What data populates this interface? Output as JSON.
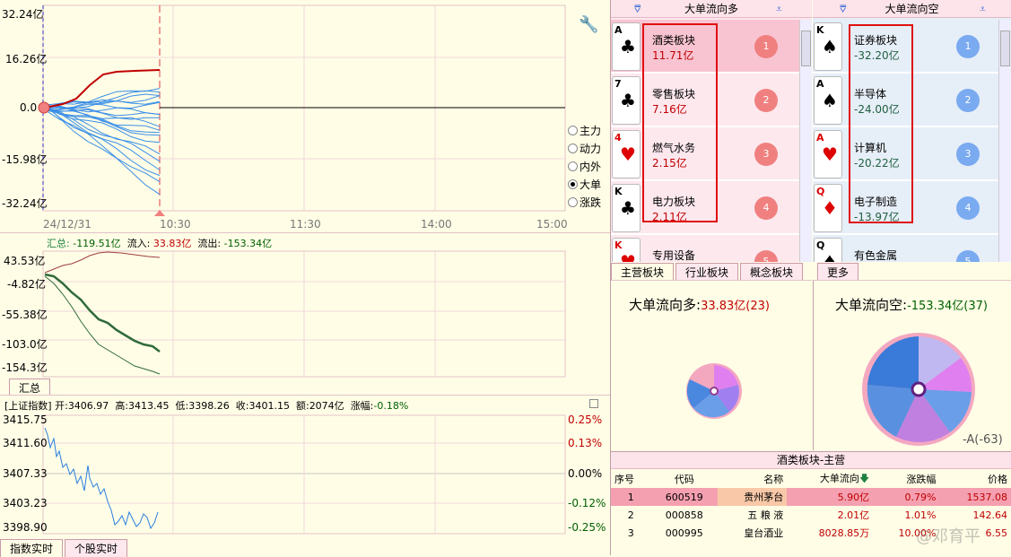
{
  "top_chart": {
    "y_ticks": [
      "32.24亿",
      "16.26亿",
      "0.0",
      "-15.98亿",
      "-32.24亿"
    ],
    "x_ticks": [
      "24/12/31",
      "10:30",
      "11:30",
      "14:00",
      "15:00"
    ],
    "y_range": [
      -32.24,
      32.24
    ],
    "highlight_final": 12.0
  },
  "radio_options": [
    {
      "label": "主力",
      "checked": false
    },
    {
      "label": "动力",
      "checked": false
    },
    {
      "label": "内外",
      "checked": false
    },
    {
      "label": "大单",
      "checked": true
    },
    {
      "label": "涨跌",
      "checked": false
    }
  ],
  "mid_chart": {
    "header": {
      "summary_label": "汇总:",
      "summary_value": "-119.51亿",
      "in_label": "流入:",
      "in_value": "33.83亿",
      "out_label": "流出:",
      "out_value": "-153.34亿"
    },
    "y_ticks": [
      "43.53亿",
      "-4.82亿",
      "-55.38亿",
      "-103.0亿",
      "-154.3亿"
    ],
    "tab": "汇总"
  },
  "index_chart": {
    "header": {
      "name": "[上证指数]",
      "open_label": "开:",
      "open": "3406.97",
      "high_label": "高:",
      "high": "3413.45",
      "low_label": "低:",
      "low": "3398.26",
      "close_label": "收:",
      "close": "3401.15",
      "amount_label": "额:",
      "amount": "2074亿",
      "change_label": "涨幅:",
      "change": "-0.18%"
    },
    "y_left": [
      "3415.75",
      "3411.60",
      "3407.33",
      "3403.23",
      "3398.90"
    ],
    "y_right": [
      "0.25%",
      "0.13%",
      "0.00%",
      "-0.12%",
      "-0.25%"
    ]
  },
  "bottom_tabs": [
    "指数实时",
    "个股实时"
  ],
  "inflow": {
    "title": "大单流向多",
    "items": [
      {
        "card_rank": "A",
        "card_suit": "♣",
        "name": "酒类板块",
        "value": "11.71亿",
        "rank": "1"
      },
      {
        "card_rank": "7",
        "card_suit": "♣",
        "name": "零售板块",
        "value": "7.16亿",
        "rank": "2"
      },
      {
        "card_rank": "4",
        "card_suit": "♥",
        "name": "燃气水务",
        "value": "2.15亿",
        "rank": "3"
      },
      {
        "card_rank": "K",
        "card_suit": "♣",
        "name": "电力板块",
        "value": "2.11亿",
        "rank": "4"
      },
      {
        "card_rank": "K",
        "card_suit": "♥",
        "name": "专用设备",
        "value": "",
        "rank": "5"
      }
    ]
  },
  "outflow": {
    "title": "大单流向空",
    "items": [
      {
        "card_rank": "K",
        "card_suit": "♠",
        "name": "证券板块",
        "value": "-32.20亿",
        "rank": "1"
      },
      {
        "card_rank": "A",
        "card_suit": "♠",
        "name": "半导体",
        "value": "-24.00亿",
        "rank": "2"
      },
      {
        "card_rank": "A",
        "card_suit": "♥",
        "name": "计算机",
        "value": "-20.22亿",
        "rank": "3"
      },
      {
        "card_rank": "Q",
        "card_suit": "♦",
        "name": "电子制造",
        "value": "-13.97亿",
        "rank": "4"
      },
      {
        "card_rank": "Q",
        "card_suit": "♠",
        "name": "有色金属",
        "value": "",
        "rank": "5"
      }
    ]
  },
  "sector_tabs": [
    "主营板块",
    "行业板块",
    "概念板块",
    "更多"
  ],
  "pie_left": {
    "label": "大单流向多:",
    "value": "33.83亿(23)"
  },
  "pie_right": {
    "label": "大单流向空:",
    "value": "-153.34亿(37)",
    "footer": "-A(-63)"
  },
  "stock_table": {
    "title": "酒类板块-主营",
    "columns": [
      "序号",
      "代码",
      "名称",
      "大单流向",
      "涨跌幅",
      "价格"
    ],
    "rows": [
      [
        "1",
        "600519",
        "贵州茅台",
        "5.90亿",
        "0.79%",
        "1537.08"
      ],
      [
        "2",
        "000858",
        "五 粮 液",
        "2.01亿",
        "1.01%",
        "142.64"
      ],
      [
        "3",
        "000995",
        "皇台酒业",
        "8028.85万",
        "10.00%",
        "6.55"
      ]
    ]
  },
  "watermark": "@邓育平"
}
